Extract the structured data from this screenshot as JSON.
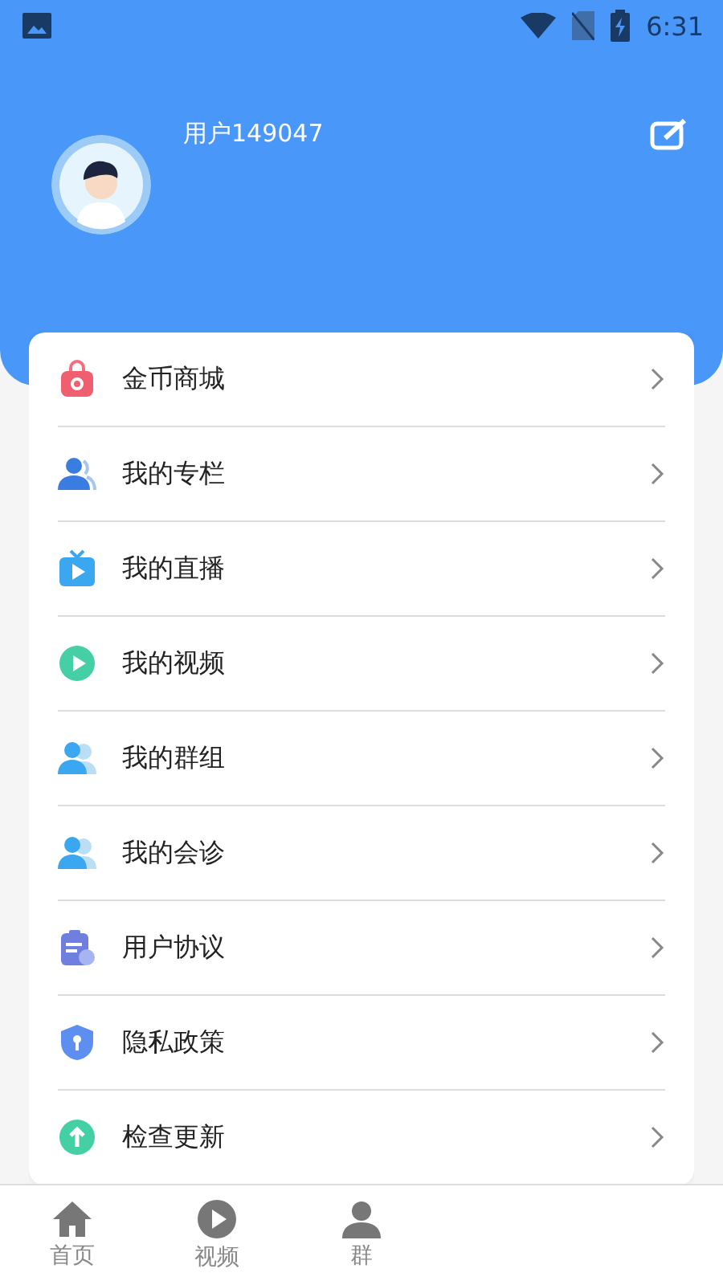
{
  "status_bar": {
    "time": "6:31"
  },
  "profile": {
    "username": "用户149047"
  },
  "menu": [
    {
      "label": "金币商城"
    },
    {
      "label": "我的专栏"
    },
    {
      "label": "我的直播"
    },
    {
      "label": "我的视频"
    },
    {
      "label": "我的群组"
    },
    {
      "label": "我的会诊"
    },
    {
      "label": "用户协议"
    },
    {
      "label": "隐私政策"
    },
    {
      "label": "检查更新"
    }
  ],
  "bottom_nav": [
    {
      "label": "首页",
      "selected": false
    },
    {
      "label": "视频",
      "selected": false
    },
    {
      "label": "群",
      "selected": false
    }
  ]
}
